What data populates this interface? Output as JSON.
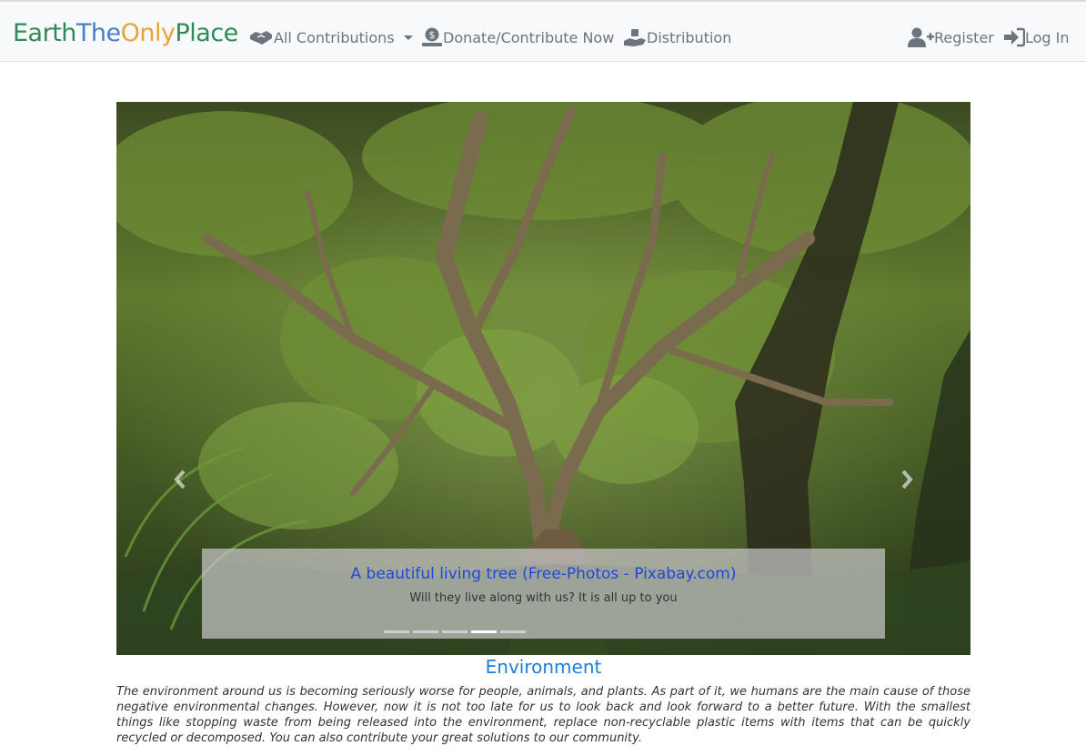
{
  "brand": {
    "part1": "Earth",
    "part2": "The",
    "part3": "Only",
    "part4": "Place",
    "colors": [
      "#2e8b57",
      "#4a7fc1",
      "#e8a33a",
      "#2e8b57"
    ]
  },
  "nav": {
    "all_contributions": "All Contributions",
    "donate": "Donate/Contribute Now",
    "distribution": "Distribution",
    "register": "Register",
    "login": "Log In"
  },
  "carousel": {
    "caption_title": "A beautiful living tree (Free-Photos - Pixabay.com)",
    "caption_text": "Will they live along with us? It is all up to you",
    "slide_count": 5,
    "active_slide": 4
  },
  "section": {
    "title": "Environment",
    "body": "The environment around us is becoming seriously worse for people, animals, and plants. As part of it, we humans are the main cause of those negative environmental changes. However, now it is not too late for us to look back and look forward to a better future. With the smallest things like stopping waste from being released into the environment, replace non-recyclable plastic items with items that can be quickly recycled or decomposed. You can also contribute your great solutions to our community."
  },
  "icons": {
    "all_contributions": "handshake-icon",
    "donate": "donate-hand-icon",
    "distribution": "hand-holding-icon",
    "register": "user-plus-icon",
    "login": "sign-in-icon"
  }
}
